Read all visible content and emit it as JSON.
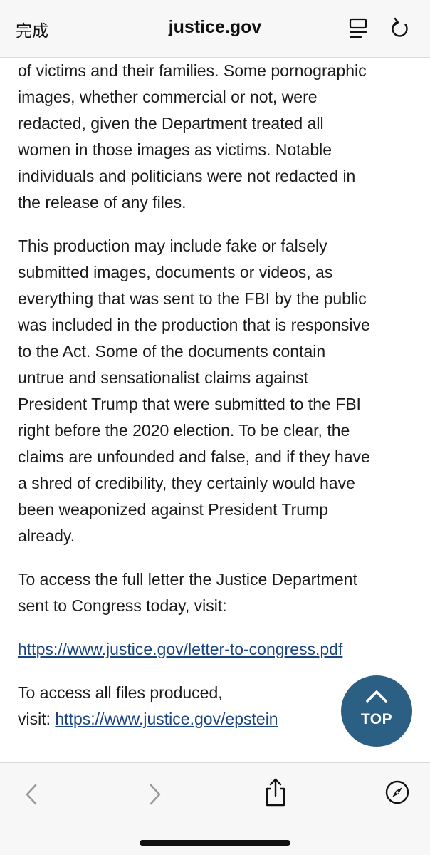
{
  "topbar": {
    "done_label": "完成",
    "domain": "justice.gov",
    "icons": [
      "reader-mode-icon",
      "reload-icon"
    ]
  },
  "content": {
    "paragraph1_lines": [
      "of victims and their families. Some pornographic",
      "images, whether commercial or not, were",
      "redacted, given the Department treated all",
      "women in those images as victims. Notable",
      "individuals and politicians were not redacted in",
      "the release of any files."
    ],
    "paragraph2_lines": [
      "This production may include fake or falsely",
      "submitted images, documents or videos, as",
      "everything that was sent to the FBI by the public",
      "was included in the production that is responsive",
      "to the Act. Some of the documents contain",
      "untrue and sensationalist claims against",
      "President Trump that were submitted to the FBI",
      "right before the 2020 election. To be clear, the",
      "claims are unfounded and false, and if they have",
      "a shred of credibility, they certainly would have",
      "been weaponized against President Trump",
      "already."
    ],
    "paragraph3_lines": [
      "To access the full letter the Justice Department",
      "sent to Congress today, visit:"
    ],
    "letter_link": "https://www.justice.gov/letter-to-congress.pdf",
    "paragraph5_line1": "To access all files produced,",
    "paragraph5_prefix": "visit: ",
    "epstein_link": "https://www.justice.gov/epstein"
  },
  "top_button": {
    "label": "TOP",
    "color": "#2c5f84"
  },
  "bottombar": {
    "icons": [
      "back-icon",
      "forward-icon",
      "share-icon",
      "compass-icon"
    ]
  }
}
